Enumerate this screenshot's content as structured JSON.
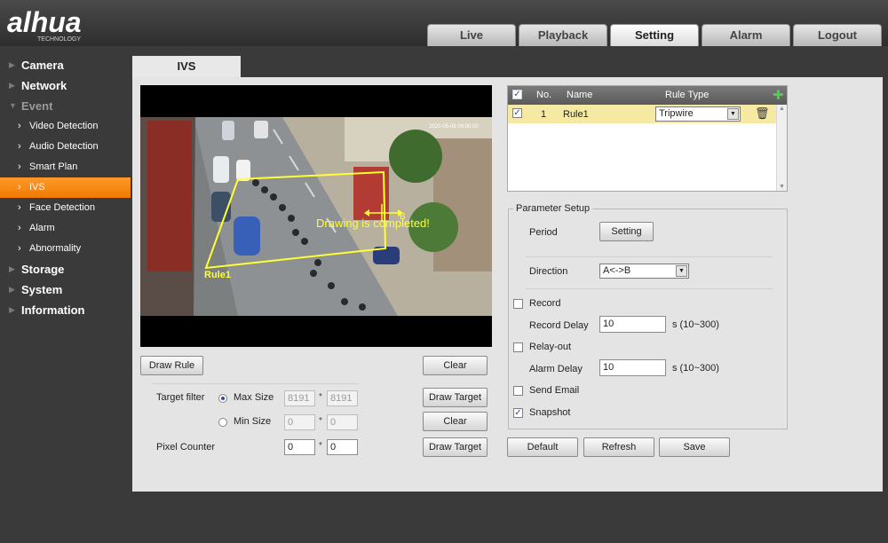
{
  "header": {
    "logo_text": "alhua",
    "logo_sub": "TECHNOLOGY",
    "tabs": [
      {
        "label": "Live"
      },
      {
        "label": "Playback"
      },
      {
        "label": "Setting",
        "active": true
      },
      {
        "label": "Alarm"
      },
      {
        "label": "Logout"
      }
    ]
  },
  "sidebar": {
    "camera": "Camera",
    "network": "Network",
    "event": "Event",
    "video_detection": "Video Detection",
    "audio_detection": "Audio Detection",
    "smart_plan": "Smart Plan",
    "ivs": "IVS",
    "face_detection": "Face Detection",
    "alarm": "Alarm",
    "abnormality": "Abnormality",
    "storage": "Storage",
    "system": "System",
    "information": "Information"
  },
  "page": {
    "tab_title": "IVS"
  },
  "video": {
    "message": "Drawing is completed!",
    "rule_label": "Rule1",
    "b_label": "B"
  },
  "controls": {
    "draw_rule": "Draw Rule",
    "clear": "Clear",
    "draw_target": "Draw Target",
    "target_filter_label": "Target filter",
    "max_size_label": "Max Size",
    "min_size_label": "Min Size",
    "max_w": "8191",
    "max_h": "8191",
    "min_w": "0",
    "min_h": "0",
    "pixel_counter_label": "Pixel Counter",
    "pixel_w": "0",
    "pixel_h": "0",
    "star": "*"
  },
  "rule_table": {
    "col_no": "No.",
    "col_name": "Name",
    "col_type": "Rule Type",
    "rows": [
      {
        "no": "1",
        "name": "Rule1",
        "type": "Tripwire",
        "checked": true
      }
    ]
  },
  "parameter_setup": {
    "title": "Parameter Setup",
    "period_label": "Period",
    "setting_button": "Setting",
    "direction_label": "Direction",
    "direction_value": "A<->B",
    "record_label": "Record",
    "record_delay_label": "Record Delay",
    "record_delay_value": "10",
    "record_delay_range": "s (10~300)",
    "relay_out_label": "Relay-out",
    "alarm_delay_label": "Alarm Delay",
    "alarm_delay_value": "10",
    "alarm_delay_range": "s (10~300)",
    "send_email_label": "Send Email",
    "snapshot_label": "Snapshot",
    "snapshot_checked": true
  },
  "footer_buttons": {
    "default": "Default",
    "refresh": "Refresh",
    "save": "Save"
  },
  "colors": {
    "accent": "#f58a0e",
    "overlay": "#ffff33",
    "row_highlight": "#f6e9a4"
  }
}
